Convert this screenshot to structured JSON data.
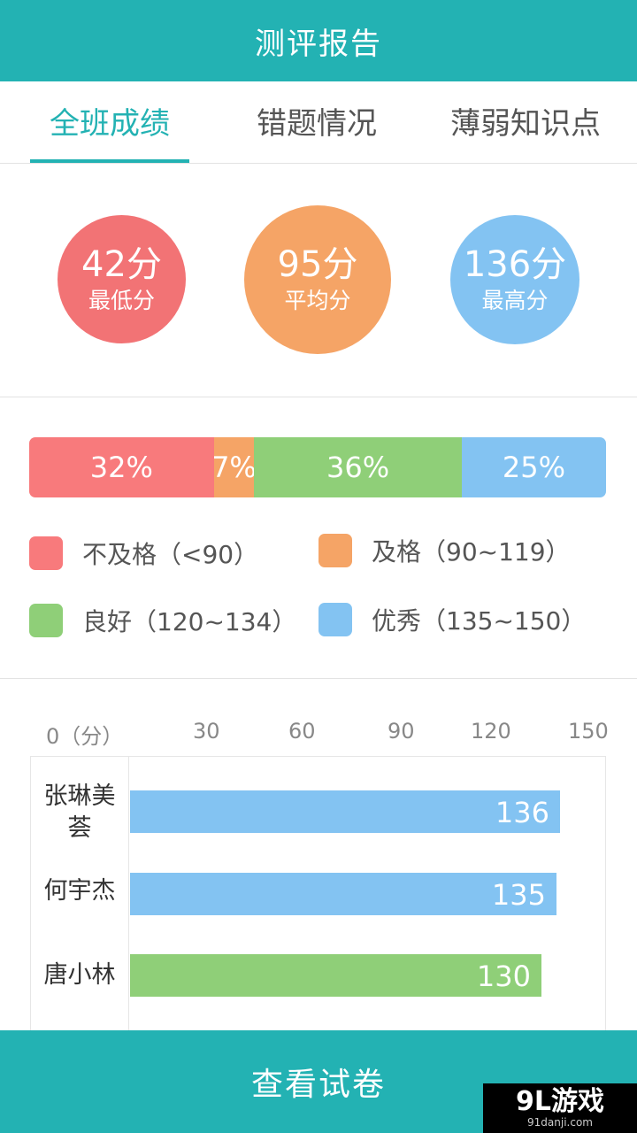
{
  "header": {
    "title": "测评报告"
  },
  "tabs": [
    {
      "label": "全班成绩",
      "active": true
    },
    {
      "label": "错题情况",
      "active": false
    },
    {
      "label": "薄弱知识点",
      "active": false
    }
  ],
  "stats": {
    "min": {
      "value": "42分",
      "label": "最低分",
      "color": "#f27375"
    },
    "avg": {
      "value": "95分",
      "label": "平均分",
      "color": "#f5a466"
    },
    "max": {
      "value": "136分",
      "label": "最高分",
      "color": "#83c3f2"
    }
  },
  "distribution": {
    "segments": [
      {
        "label": "32%",
        "percent": 32,
        "color": "#f87a7c"
      },
      {
        "label": "7%",
        "percent": 7,
        "color": "#f5a466"
      },
      {
        "label": "36%",
        "percent": 36,
        "color": "#8fcf78"
      },
      {
        "label": "25%",
        "percent": 25,
        "color": "#83c3f2"
      }
    ],
    "legend": [
      {
        "text": "不及格（<90）",
        "color": "#f87a7c"
      },
      {
        "text": "及格（90~119）",
        "color": "#f5a466"
      },
      {
        "text": "良好（120~134）",
        "color": "#8fcf78"
      },
      {
        "text": "优秀（135~150）",
        "color": "#83c3f2"
      }
    ]
  },
  "chart_data": {
    "type": "bar",
    "orientation": "horizontal",
    "xlim": [
      0,
      150
    ],
    "ticks": [
      {
        "value": 0,
        "label": "0（分）"
      },
      {
        "value": 30,
        "label": "30"
      },
      {
        "value": 60,
        "label": "60"
      },
      {
        "value": 90,
        "label": "90"
      },
      {
        "value": 120,
        "label": "120"
      },
      {
        "value": 150,
        "label": "150"
      }
    ],
    "rows": [
      {
        "name": "张琳美荟",
        "value": 136,
        "label": "136",
        "color": "#83c3f2"
      },
      {
        "name": "何宇杰",
        "value": 135,
        "label": "135",
        "color": "#83c3f2"
      },
      {
        "name": "唐小林",
        "value": 130,
        "label": "130",
        "color": "#8fcf78"
      }
    ]
  },
  "footer": {
    "button_label": "查看试卷"
  },
  "watermark": {
    "main": "9L游戏",
    "sub": "91danji.com"
  }
}
